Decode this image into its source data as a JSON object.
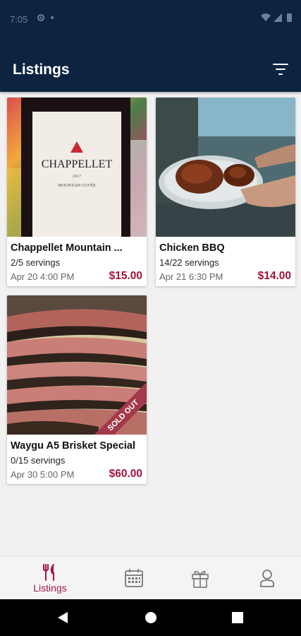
{
  "status_bar": {
    "time": "7:05",
    "icons": [
      "gear-icon",
      "dot-icon"
    ],
    "right_icons": "wifi-icon signal-icon battery-icon"
  },
  "app_bar": {
    "title": "Listings",
    "filter_icon": "filter-icon"
  },
  "listings": [
    {
      "name": "Chappellet Mountain ...",
      "servings": "2/5 servings",
      "date": "Apr 20 4:00 PM",
      "price": "$15.00",
      "label_text": "CHAPPELLET",
      "label_year": "2017",
      "label_sub": "MOUNTAIN CUVÉE",
      "sold_out": false
    },
    {
      "name": "Chicken BBQ",
      "servings": "14/22 servings",
      "date": "Apr 21 6:30 PM",
      "price": "$14.00",
      "sold_out": false
    },
    {
      "name": "Waygu A5 Brisket Special",
      "servings": "0/15 servings",
      "date": "Apr 30 5:00 PM",
      "price": "$60.00",
      "sold_out": true,
      "badge": "SOLD OUT"
    }
  ],
  "bottom_nav": {
    "items": [
      {
        "label": "Listings",
        "icon": "fork-knife-icon",
        "active": true
      },
      {
        "label": "",
        "icon": "calendar-icon",
        "active": false
      },
      {
        "label": "",
        "icon": "gift-icon",
        "active": false
      },
      {
        "label": "",
        "icon": "profile-icon",
        "active": false
      }
    ]
  },
  "colors": {
    "primary": "#0c2440",
    "accent": "#a4133c",
    "background": "#f1f1f1"
  },
  "system_nav": [
    "back-icon",
    "home-icon",
    "recents-icon"
  ]
}
